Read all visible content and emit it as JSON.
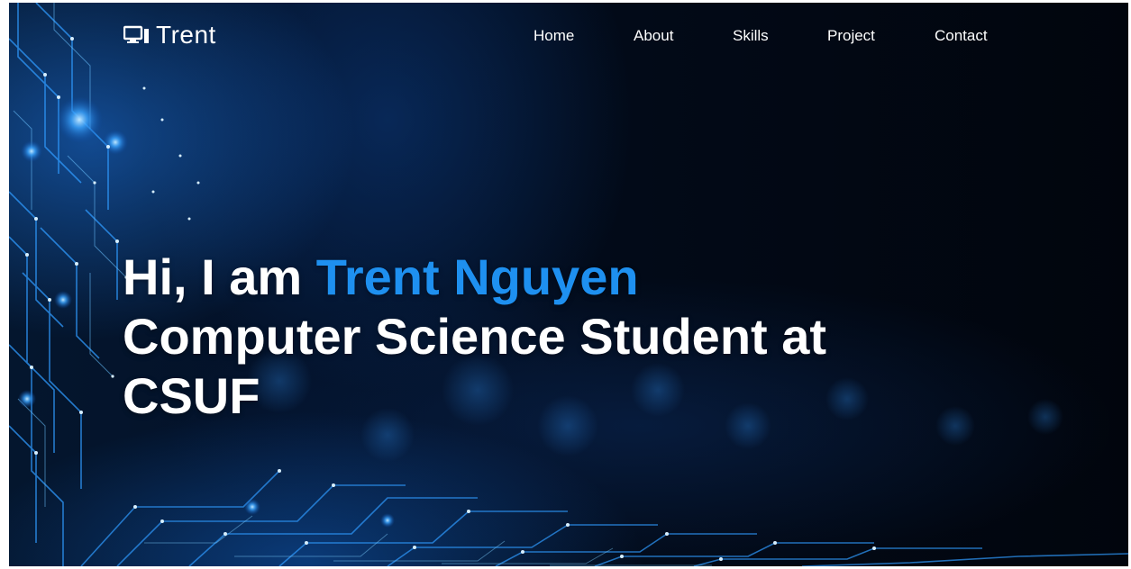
{
  "brand": {
    "name": "Trent",
    "icon": "monitor-icon",
    "icon_color": "#ffffff"
  },
  "nav": {
    "items": [
      {
        "label": "Home"
      },
      {
        "label": "About"
      },
      {
        "label": "Skills"
      },
      {
        "label": "Project"
      },
      {
        "label": "Contact"
      }
    ]
  },
  "hero": {
    "greeting": "Hi, I am",
    "name": "Trent Nguyen",
    "title_line1": "Computer Science Student at",
    "title_line2": "CSUF",
    "background": "circuit-board-image"
  },
  "colors": {
    "accent": "#1e90f0",
    "text": "#ffffff",
    "background": "#01060f"
  }
}
